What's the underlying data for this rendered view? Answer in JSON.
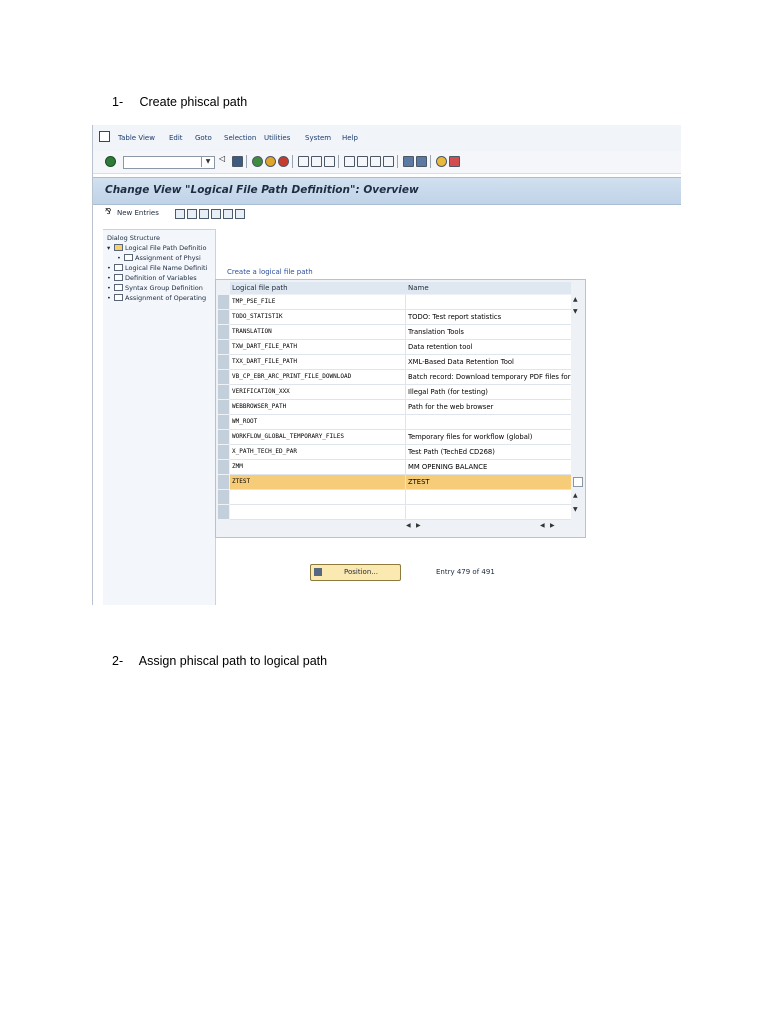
{
  "steps": [
    {
      "num": "1-",
      "text": "Create phiscal path"
    },
    {
      "num": "2-",
      "text": "Assign phiscal path to  logical path"
    }
  ],
  "menu": [
    "Table View",
    "Edit",
    "Goto",
    "Selection",
    "Utilities",
    "System",
    "Help"
  ],
  "title": "Change View \"Logical File Path Definition\": Overview",
  "app_toolbar": {
    "new_entries": "New Entries"
  },
  "dialog_structure": {
    "header": "Dialog Structure",
    "items": [
      {
        "label": "Logical File Path Definitio",
        "selected": true,
        "level": 0
      },
      {
        "label": "Assignment of Physi",
        "selected": false,
        "level": 1
      },
      {
        "label": "Logical File Name Definiti",
        "selected": false,
        "level": 0
      },
      {
        "label": "Definition of Variables",
        "selected": false,
        "level": 0
      },
      {
        "label": "Syntax Group Definition",
        "selected": false,
        "level": 0
      },
      {
        "label": "Assignment of Operating",
        "selected": false,
        "level": 0
      }
    ]
  },
  "table": {
    "caption": "Create a logical file path",
    "columns": [
      "Logical file path",
      "Name"
    ],
    "rows": [
      {
        "path": "TMP_PSE_FILE",
        "name": ""
      },
      {
        "path": "TODO_STATISTIK",
        "name": "TODO: Test report statistics"
      },
      {
        "path": "TRANSLATION",
        "name": "Translation Tools"
      },
      {
        "path": "TXW_DART_FILE_PATH",
        "name": "Data retention tool"
      },
      {
        "path": "TXX_DART_FILE_PATH",
        "name": "XML-Based Data Retention Tool"
      },
      {
        "path": "VB_CP_EBR_ARC_PRINT_FILE_DOWNLOAD",
        "name": "Batch record: Download temporary PDF files for"
      },
      {
        "path": "VERIFICATION_XXX",
        "name": "Illegal Path (for testing)"
      },
      {
        "path": "WEBBROWSER_PATH",
        "name": "Path for the web browser"
      },
      {
        "path": "WM_ROOT",
        "name": ""
      },
      {
        "path": "WORKFLOW_GLOBAL_TEMPORARY_FILES",
        "name": "Temporary files for workflow (global)"
      },
      {
        "path": "X_PATH_TECH_ED_PAR",
        "name": "Test Path (TechEd CD268)"
      },
      {
        "path": "ZMM",
        "name": "MM OPENING BALANCE"
      },
      {
        "path": "ZTEST",
        "name": "ZTEST",
        "highlighted": true
      },
      {
        "path": "",
        "name": ""
      },
      {
        "path": "",
        "name": ""
      }
    ]
  },
  "position_button": "Position...",
  "entry_info": "Entry 479 of 491"
}
